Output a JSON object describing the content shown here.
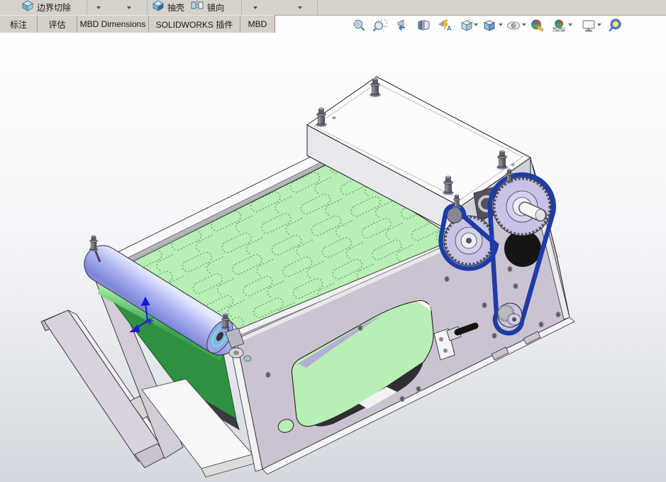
{
  "toolbar": {
    "groups": [
      {
        "icon": "boundary-cut-icon",
        "label": "边界切除"
      },
      {
        "icon": "shell-icon",
        "label": "抽壳"
      },
      {
        "icon": "mirror-icon",
        "label": "镜向"
      }
    ]
  },
  "tabs": [
    {
      "label": "标注"
    },
    {
      "label": "评估"
    },
    {
      "label": "MBD Dimensions"
    },
    {
      "label": "SOLIDWORKS 插件"
    },
    {
      "label": "MBD"
    }
  ],
  "headsup": {
    "icons": [
      "zoom-to-fit",
      "zoom-to-area",
      "previous-view",
      "section-view",
      "dynamic-annotation-views",
      "view-orientation",
      "display-style",
      "hide-show-items",
      "edit-appearance",
      "apply-scene",
      "view-settings",
      "magnifying-glass"
    ]
  },
  "colors": {
    "toolbar_bg": "#d6d2cb",
    "tab_border": "#a6a29a",
    "viewport_top": "#ffffff",
    "viewport_bottom": "#d5d8de",
    "belt_green": "#b7efb4",
    "belt_dark_green": "#2e9140",
    "roller_blue": "#9aa3f0",
    "drive_belt_blue": "#1d3ca6",
    "frame_lavender": "#cbc3d1",
    "sprocket_lavender": "#c7c3e6"
  }
}
